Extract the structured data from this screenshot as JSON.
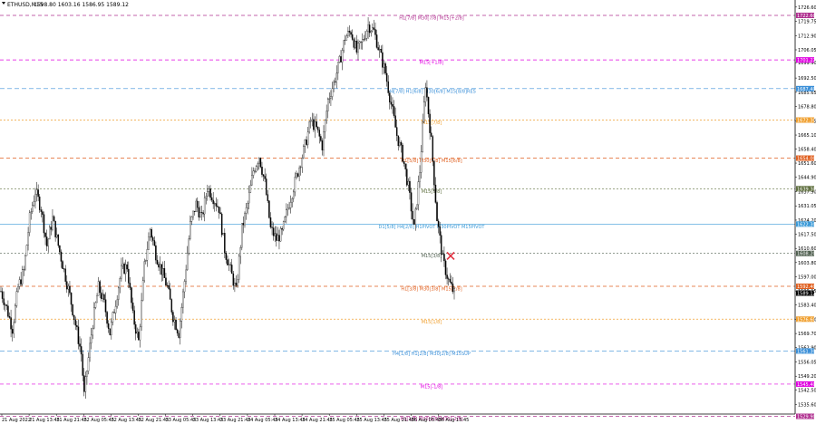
{
  "header": {
    "symbol": "ETHUSD,M15",
    "ohlc": "1598.80 1603.16 1586.95 1589.12"
  },
  "colors": {
    "bull": "#000000",
    "bear": "#000000",
    "background": "#ffffff",
    "frame": "#000000"
  },
  "chart_data": {
    "type": "candlestick",
    "y_axis": {
      "min": 1531.0,
      "max": 1730.0,
      "ticks": [
        "1726.60",
        "1719.75",
        "1712.90",
        "1706.05",
        "1699.90",
        "1692.50",
        "1685.65",
        "1678.80",
        "1671.95",
        "1665.10",
        "1658.40",
        "1651.60",
        "1644.90",
        "1637.90",
        "1631.05",
        "1624.20",
        "1617.50",
        "1610.60",
        "1603.80",
        "1597.00",
        "1590.15",
        "1583.40",
        "1576.50",
        "1569.70",
        "1562.90",
        "1556.05",
        "1549.20",
        "1542.50",
        "1535.60",
        "1528.80"
      ]
    },
    "x_axis": {
      "labels": [
        "21 Aug 2022",
        "21 Aug 13:45",
        "21 Aug 21:45",
        "22 Aug 05:45",
        "22 Aug 13:45",
        "22 Aug 21:45",
        "23 Aug 05:45",
        "23 Aug 13:45",
        "23 Aug 21:45",
        "24 Aug 05:45",
        "24 Aug 13:45",
        "24 Aug 21:45",
        "25 Aug 05:45",
        "25 Aug 13:45",
        "25 Aug 21:45",
        "26 Aug 05:45",
        "26 Aug 13:45"
      ]
    },
    "levels": [
      {
        "label": "H1[7/8] M30[7/8] M15[+2/8]",
        "price": 1722.6,
        "tag": "1722.60",
        "color": "#b03090",
        "dash": "4,3"
      },
      {
        "label": "M15[+1/8]",
        "price": 1701.2,
        "tag": "1701.22",
        "color": "#e000e0",
        "dash": "4,3"
      },
      {
        "label": "H4[7/8] H1[6/8] M30[6/8] M15[8/8]RES",
        "price": 1687.4,
        "tag": "1687.40",
        "color": "#3a8fd8",
        "dash": "5,3"
      },
      {
        "label": "M15[7/8]",
        "price": 1672.3,
        "tag": "1672.30",
        "color": "#f0a030",
        "dash": "2,2"
      },
      {
        "label": "H1[5/8] M30[5/8] M15[6/8]",
        "price": 1654.0,
        "tag": "1654.00",
        "color": "#e06020",
        "dash": "4,3"
      },
      {
        "label": "M15[5/8]",
        "price": 1639.3,
        "tag": "1639.30",
        "color": "#607040",
        "dash": "2,2"
      },
      {
        "label": "D1[5/8] H4[2/8] H1PIVOT M30PIVOT M15PIVOT",
        "price": 1622.3,
        "tag": "1622.30",
        "color": "#3a9ad8",
        "dash": ""
      },
      {
        "label": "M15[3/8]",
        "price": 1608.2,
        "tag": "1608.20",
        "color": "#506050",
        "dash": "2,2"
      },
      {
        "label": "H1[3/8] M30[3/8] M15[2/8]",
        "price": 1592.4,
        "tag": "1592.40",
        "color": "#e06020",
        "dash": "4,3"
      },
      {
        "label": "M15[1/8]",
        "price": 1576.6,
        "tag": "1576.60",
        "color": "#f0a030",
        "dash": "2,2"
      },
      {
        "label": "H4[1/8] H1[2/8] M30[2/8] M15SUP",
        "price": 1561.3,
        "tag": "1561.30",
        "color": "#3a8fd8",
        "dash": "5,3"
      },
      {
        "label": "M15[-1/8]",
        "price": 1545.4,
        "tag": "1545.40",
        "color": "#e000e0",
        "dash": "4,3"
      },
      {
        "label": "H1[1/8] M30[1/8] M15[-2/8]",
        "price": 1529.9,
        "tag": "1529.90",
        "color": "#b03090",
        "dash": "4,3"
      }
    ],
    "current_price": {
      "value": 1589.12,
      "tag": "1589.12",
      "color": "#000000"
    },
    "marker": {
      "type": "cross",
      "price": 1607.0,
      "color": "#e03040"
    },
    "key_points": [
      [
        0,
        1590
      ],
      [
        4,
        1582
      ],
      [
        8,
        1572
      ],
      [
        12,
        1592
      ],
      [
        16,
        1600
      ],
      [
        20,
        1625
      ],
      [
        24,
        1638
      ],
      [
        28,
        1630
      ],
      [
        32,
        1612
      ],
      [
        36,
        1625
      ],
      [
        40,
        1612
      ],
      [
        44,
        1600
      ],
      [
        48,
        1588
      ],
      [
        52,
        1574
      ],
      [
        56,
        1560
      ],
      [
        58,
        1540
      ],
      [
        60,
        1552
      ],
      [
        64,
        1575
      ],
      [
        68,
        1592
      ],
      [
        72,
        1584
      ],
      [
        76,
        1570
      ],
      [
        80,
        1585
      ],
      [
        84,
        1600
      ],
      [
        88,
        1602
      ],
      [
        92,
        1578
      ],
      [
        96,
        1566
      ],
      [
        100,
        1602
      ],
      [
        104,
        1620
      ],
      [
        108,
        1608
      ],
      [
        112,
        1600
      ],
      [
        116,
        1592
      ],
      [
        120,
        1578
      ],
      [
        124,
        1570
      ],
      [
        128,
        1595
      ],
      [
        132,
        1622
      ],
      [
        136,
        1632
      ],
      [
        140,
        1625
      ],
      [
        144,
        1640
      ],
      [
        148,
        1635
      ],
      [
        152,
        1630
      ],
      [
        156,
        1610
      ],
      [
        160,
        1600
      ],
      [
        164,
        1590
      ],
      [
        168,
        1620
      ],
      [
        172,
        1632
      ],
      [
        176,
        1648
      ],
      [
        180,
        1655
      ],
      [
        184,
        1642
      ],
      [
        188,
        1620
      ],
      [
        192,
        1615
      ],
      [
        196,
        1618
      ],
      [
        200,
        1630
      ],
      [
        204,
        1640
      ],
      [
        208,
        1650
      ],
      [
        212,
        1660
      ],
      [
        216,
        1672
      ],
      [
        220,
        1668
      ],
      [
        224,
        1660
      ],
      [
        228,
        1682
      ],
      [
        232,
        1690
      ],
      [
        236,
        1700
      ],
      [
        240,
        1712
      ],
      [
        244,
        1715
      ],
      [
        248,
        1705
      ],
      [
        252,
        1710
      ],
      [
        256,
        1718
      ],
      [
        260,
        1715
      ],
      [
        264,
        1705
      ],
      [
        268,
        1695
      ],
      [
        272,
        1680
      ],
      [
        276,
        1665
      ],
      [
        280,
        1655
      ],
      [
        284,
        1640
      ],
      [
        288,
        1620
      ],
      [
        292,
        1648
      ],
      [
        296,
        1690
      ],
      [
        300,
        1662
      ],
      [
        304,
        1625
      ],
      [
        308,
        1605
      ],
      [
        312,
        1595
      ],
      [
        316,
        1589
      ]
    ]
  }
}
